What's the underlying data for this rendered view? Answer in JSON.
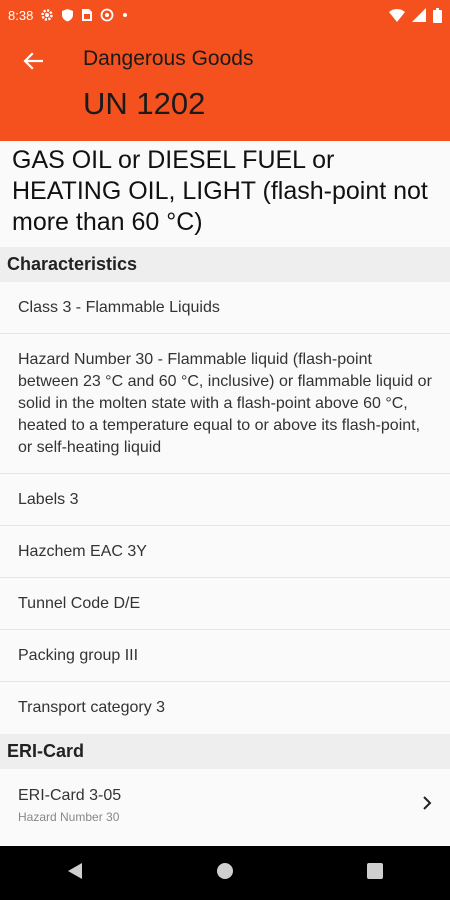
{
  "status_bar": {
    "time": "8:38",
    "left_icons": [
      "gear-icon",
      "shield-icon",
      "sim-card-icon",
      "a-circle-icon",
      "dot-icon"
    ],
    "right_icons": [
      "wifi-icon",
      "signal-icon",
      "battery-icon"
    ]
  },
  "appbar": {
    "subtitle": "Dangerous Goods",
    "title": "UN 1202",
    "color": "#f4511e"
  },
  "goods_name": "GAS OIL or DIESEL FUEL or HEATING OIL, LIGHT (flash-point not more than 60 °C)",
  "characteristics": {
    "header": "Characteristics",
    "items": [
      "Class 3 - Flammable Liquids",
      "Hazard Number 30 - Flammable liquid (flash-point between 23 °C and 60 °C, inclusive) or flammable liquid or solid in the molten state with a flash-point above 60 °C, heated to a temperature equal to or above its flash-point, or self-heating liquid",
      "Labels 3",
      "Hazchem EAC 3Y",
      "Tunnel Code D/E",
      "Packing group III",
      "Transport category 3"
    ]
  },
  "eri_card": {
    "header": "ERI-Card",
    "title": "ERI-Card 3-05",
    "subtitle": "Hazard Number 30"
  },
  "nav_bar": {
    "buttons": [
      "back-triangle-icon",
      "home-circle-icon",
      "recents-square-icon"
    ]
  }
}
